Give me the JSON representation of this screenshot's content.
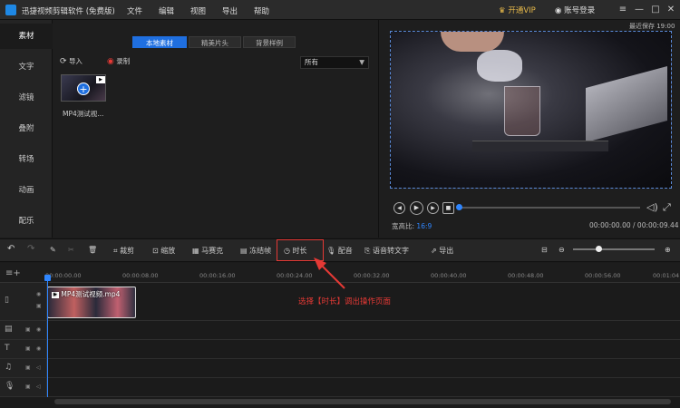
{
  "app": {
    "title": "迅捷视频剪辑软件 (免费版)"
  },
  "menu": [
    "文件",
    "编辑",
    "视图",
    "导出",
    "帮助"
  ],
  "account": {
    "vip_label": "开通VIP",
    "login_label": "账号登录"
  },
  "sidebar": {
    "items": [
      "素材",
      "文字",
      "滤镜",
      "叠附",
      "转场",
      "动画",
      "配乐"
    ],
    "active": "素材"
  },
  "media": {
    "tabs": [
      "本地素材",
      "精美片头",
      "背景样例"
    ],
    "import_label": "导入",
    "record_label": "录制",
    "filter_value": "所有",
    "clip_name": "MP4测试视..."
  },
  "preview": {
    "save_status": "最近保存 19:00",
    "ratio_label": "宽高比:",
    "ratio_value": "16:9",
    "time_current": "00:00:00.00",
    "time_total": "00:00:09.44",
    "progress": 0.0
  },
  "toolbar": {
    "crop": "裁剪",
    "zoom": "缩放",
    "mosaic": "马赛克",
    "freeze": "冻结帧",
    "duration": "时长",
    "dubbing": "配音",
    "speech_to_text": "语音转文字",
    "export": "导出"
  },
  "ruler": {
    "ticks": [
      "00:00:00.00",
      "00:00:08.00",
      "00:00:16.00",
      "00:00:24.00",
      "00:00:32.00",
      "00:00:40.00",
      "00:00:48.00",
      "00:00:56.00",
      "00:01:04"
    ]
  },
  "timeline": {
    "clip_label": "MP4测试视频.mp4"
  },
  "annotation": "选择【时长】调出操作页面",
  "colors": {
    "accent": "#1f6fe0",
    "highlight": "#e53935",
    "vip": "#e6b84a"
  }
}
